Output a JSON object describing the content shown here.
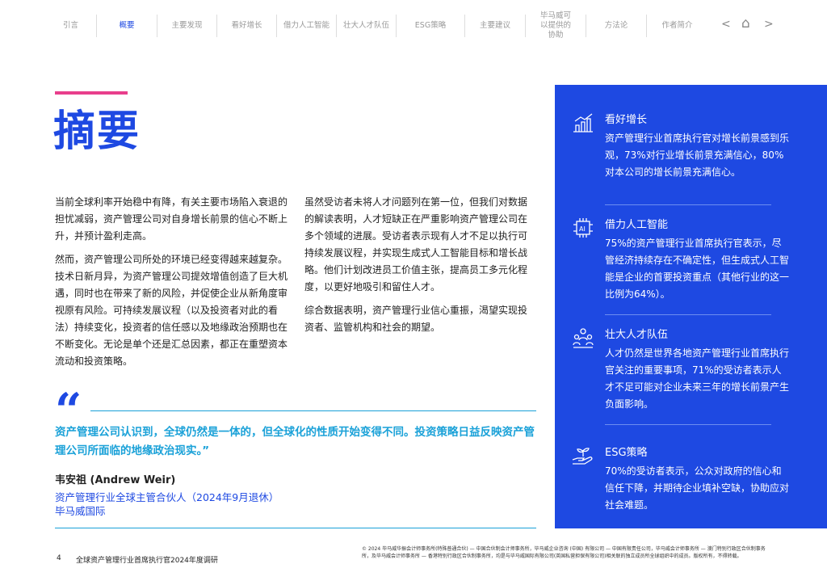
{
  "nav": {
    "items": [
      "引言",
      "概要",
      "主要发现",
      "看好增长",
      "借力人工智能",
      "壮大人才队伍",
      "ESG策略",
      "主要建议",
      "毕马威可以提供的协助",
      "方法论",
      "作者简介"
    ],
    "active": 1,
    "prev": "<",
    "home": "⌂",
    "next": ">"
  },
  "title": "摘要",
  "col1": [
    "当前全球利率开始稳中有降，有关主要市场陷入衰退的担忧减弱，资产管理公司对自身增长前景的信心不断上升，并预计盈利走高。",
    "然而，资产管理公司所处的环境已经变得越来越复杂。技术日新月异，为资产管理公司提效增值创造了巨大机遇，同时也在带来了新的风险，并促使企业从新角度审视原有风险。可持续发展议程（以及投资者对此的看法）持续变化，投资者的信任感以及地缘政治预期也在不断变化。无论是单个还是汇总因素，都正在重塑资本流动和投资策略。"
  ],
  "col2": [
    "虽然受访者未将人才问题列在第一位，但我们对数据的解读表明，人才短缺正在严重影响资产管理公司在多个领域的进展。受访者表示现有人才不足以执行可持续发展议程，并实现生成式人工智能目标和增长战略。他们计划改进员工价值主张，提高员工多元化程度，以更好地吸引和留住人才。",
    "综合数据表明，资产管理行业信心重振，渴望实现投资者、监管机构和社会的期望。"
  ],
  "quote": {
    "mark": "“",
    "text": "资产管理公司认识到，全球仍然是一体的，但全球化的性质开始变得不同。投资策略日益反映资产管理公司所面临的地缘政治现实。”",
    "name": "韦安祖 (Andrew Weir)",
    "role": "资产管理行业全球主管合伙人（2024年9月退休）",
    "org": "毕马威国际"
  },
  "footer": {
    "page": "4",
    "title": "全球资产管理行业首席执行官2024年度调研",
    "legal": "© 2024 毕马威华振会计师事务所(特殊普通合伙) — 中国合伙制会计师事务所，毕马威企业咨询 (中国) 有限公司 — 中国有限责任公司，毕马威会计师事务所 — 澳门特别行政区合伙制事务所，及毕马威会计师事务所 — 香港特别行政区合伙制事务所，均是与毕马威国际有限公司(英国私营担保有限公司)相关联的独立成员所全球组织中的成员。版权所有，不得转载。"
  },
  "panel": [
    {
      "icon": "growth-chart-icon",
      "title": "看好增长",
      "text": "资产管理行业首席执行官对增长前景感到乐观，73%对行业增长前景充满信心，80%对本公司的增长前景充满信心。"
    },
    {
      "icon": "ai-chip-icon",
      "title": "借力人工智能",
      "text": "75%的资产管理行业首席执行官表示，尽管经济持续存在不确定性，但生成式人工智能是企业的首要投资重点（其他行业的这一比例为64%）。"
    },
    {
      "icon": "people-icon",
      "title": "壮大人才队伍",
      "text": "人才仍然是世界各地资产管理行业首席执行官关注的重要事项，71%的受访者表示人才不足可能对企业未来三年的增长前景产生负面影响。"
    },
    {
      "icon": "plant-hand-icon",
      "title": "ESG策略",
      "text": "70%的受访者表示，公众对政府的信心和信任下降，并期待企业填补空缺，协助应对社会难题。"
    }
  ]
}
